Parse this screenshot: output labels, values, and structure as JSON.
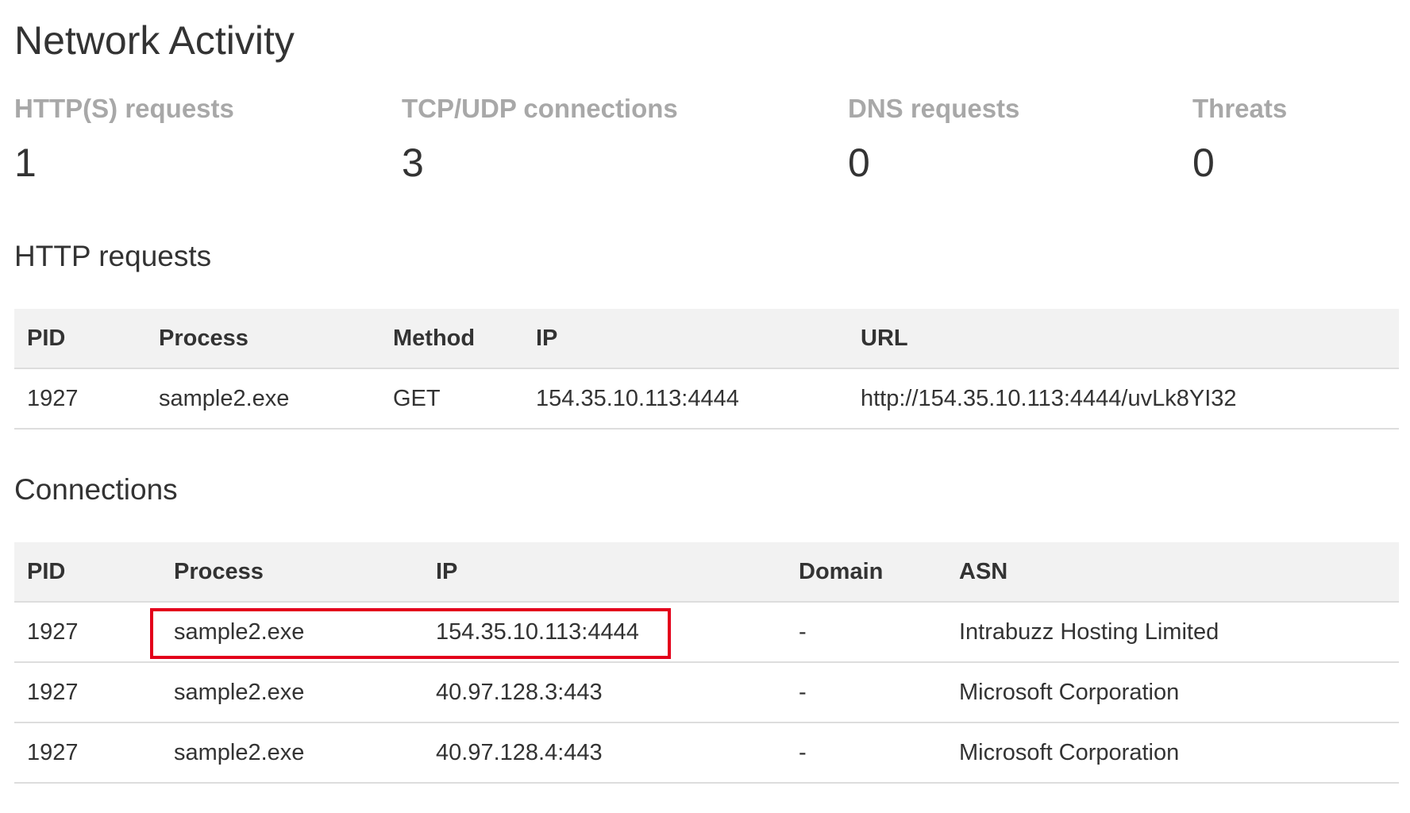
{
  "page_title": "Network Activity",
  "stats": [
    {
      "label": "HTTP(S) requests",
      "value": "1"
    },
    {
      "label": "TCP/UDP connections",
      "value": "3"
    },
    {
      "label": "DNS requests",
      "value": "0"
    },
    {
      "label": "Threats",
      "value": "0"
    }
  ],
  "http_requests": {
    "title": "HTTP requests",
    "columns": [
      "PID",
      "Process",
      "Method",
      "IP",
      "URL"
    ],
    "rows": [
      [
        "1927",
        "sample2.exe",
        "GET",
        "154.35.10.113:4444",
        "http://154.35.10.113:4444/uvLk8YI32"
      ]
    ]
  },
  "connections": {
    "title": "Connections",
    "columns": [
      "PID",
      "Process",
      "IP",
      "Domain",
      "ASN"
    ],
    "rows": [
      [
        "1927",
        "sample2.exe",
        "154.35.10.113:4444",
        "-",
        "Intrabuzz Hosting Limited"
      ],
      [
        "1927",
        "sample2.exe",
        "40.97.128.3:443",
        "-",
        "Microsoft Corporation"
      ],
      [
        "1927",
        "sample2.exe",
        "40.97.128.4:443",
        "-",
        "Microsoft Corporation"
      ]
    ]
  },
  "colors": {
    "highlight": "#e3001b",
    "header_bg": "#f2f2f2",
    "stat_label": "#a8a8a8"
  }
}
